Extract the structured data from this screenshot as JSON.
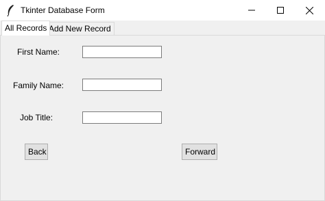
{
  "window": {
    "title": "Tkinter Database Form",
    "app_icon": "feather-icon",
    "controls": [
      "minimize-icon",
      "maximize-icon",
      "close-icon"
    ]
  },
  "tabs": [
    {
      "label": "All Records",
      "active": true
    },
    {
      "label": "Add New Record",
      "active": false
    }
  ],
  "form": {
    "first_name_label": "First Name:",
    "first_name_value": "",
    "family_name_label": "Family Name:",
    "family_name_value": "",
    "job_title_label": "Job Title:",
    "job_title_value": ""
  },
  "buttons": {
    "back": "Back",
    "forward": "Forward"
  },
  "colors": {
    "window_bg": "#f0f0f0",
    "titlebar_bg": "#ffffff",
    "button_bg": "#e1e1e1"
  }
}
